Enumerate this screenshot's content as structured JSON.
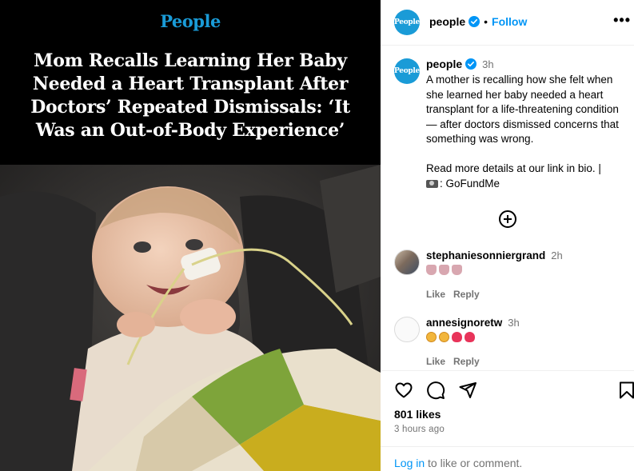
{
  "media": {
    "brand": "People",
    "headline": "Mom Recalls Learning Her Baby Needed a Heart Transplant After Doctors’ Repeated Dismissals: ‘It Was an Out-of-Body Experience’"
  },
  "header": {
    "avatar_text": "People",
    "username": "people",
    "separator": "•",
    "follow_label": "Follow",
    "more_label": "•••"
  },
  "caption": {
    "avatar_text": "People",
    "username": "people",
    "time": "3h",
    "text": "A mother is recalling how she felt when she learned her baby needed a heart transplant for a life-threatening condition — after doctors dismissed concerns that something was wrong.\n\nRead more details at our link in bio. |",
    "credit": ": GoFundMe"
  },
  "comments": [
    {
      "username": "stephaniesonniergrand",
      "time": "2h",
      "emoji": [
        "folded-hands",
        "folded-hands",
        "folded-hands"
      ],
      "like_label": "Like",
      "reply_label": "Reply"
    },
    {
      "username": "annesignoretw",
      "time": "3h",
      "emoji": [
        "pleading-face",
        "pleading-face",
        "red-heart",
        "red-heart"
      ],
      "like_label": "Like",
      "reply_label": "Reply"
    }
  ],
  "footer": {
    "likes": "801 likes",
    "posted": "3 hours ago",
    "login_link": "Log in",
    "login_suffix": " to like or comment."
  }
}
